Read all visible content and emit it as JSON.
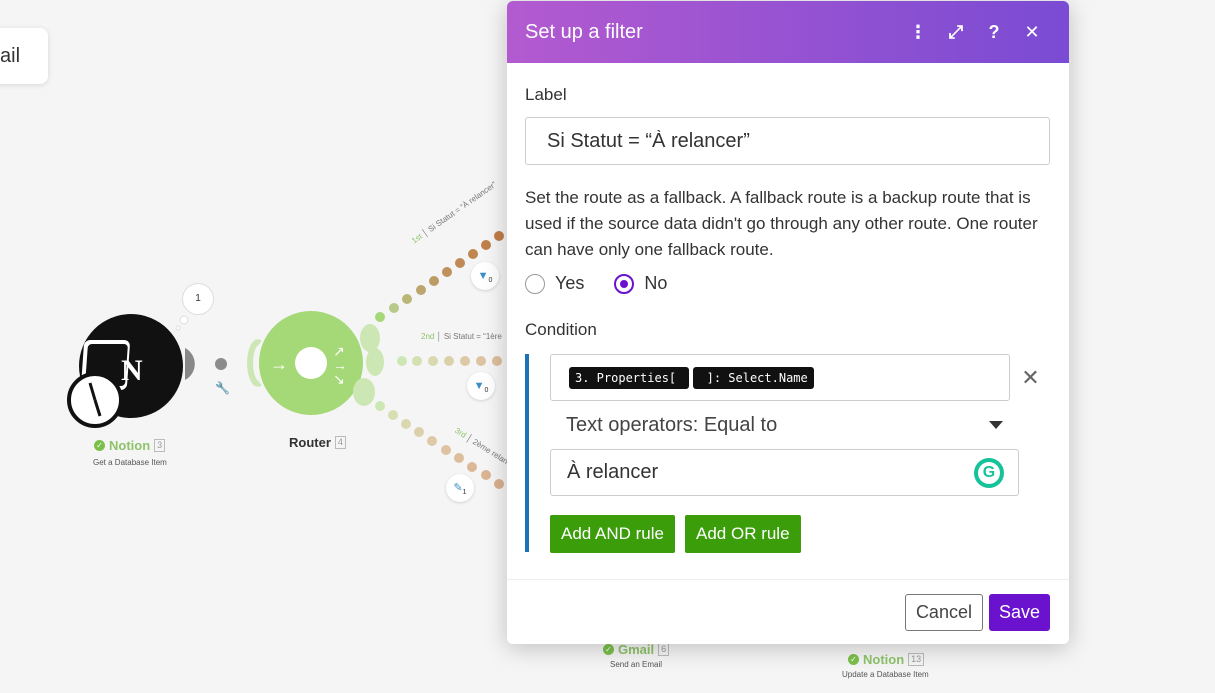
{
  "canvas": {
    "toast_text": "ail",
    "notion_module": {
      "name": "Notion",
      "number": "3",
      "subtitle": "Get a Database Item",
      "ops_count": "1"
    },
    "router_module": {
      "name": "Router",
      "number": "4"
    },
    "gmail_module": {
      "name": "Gmail",
      "number": "6",
      "subtitle": "Send an Email"
    },
    "notion_update_module": {
      "name": "Notion",
      "number": "13",
      "subtitle": "Update a Database Item"
    },
    "routes": [
      {
        "order": "1st",
        "label": "Si Statut = “À relancer”",
        "filter_count": "0"
      },
      {
        "order": "2nd",
        "label": "Si Statut = “1ère",
        "filter_count": "0"
      },
      {
        "order": "3rd",
        "label": "2ème relan",
        "tool_count": "1"
      }
    ]
  },
  "dialog": {
    "title": "Set up a filter",
    "header_icons": [
      "more-vertical-icon",
      "expand-icon",
      "help-icon",
      "close-icon"
    ],
    "label_heading": "Label",
    "label_value": "Si Statut = “À relancer”",
    "fallback_help": "Set the route as a fallback. A fallback route is a backup route that is used if the source data didn't go through any other route. One router can have only one fallback route.",
    "fallback_options": {
      "yes": "Yes",
      "no": "No",
      "selected": "No"
    },
    "condition_heading": "Condition",
    "condition": {
      "operand_pills": [
        "3. Properties[ ",
        " ]: Select.Name"
      ],
      "operator": "Text operators: Equal to",
      "value": "À relancer"
    },
    "add_and_rule": "Add AND rule",
    "add_or_rule": "Add OR rule",
    "cancel": "Cancel",
    "save": "Save"
  },
  "colors": {
    "header_gradient_start": "#b35ad0",
    "header_gradient_end": "#7a4bd3",
    "save_button": "#6b12cf",
    "rule_buttons": "#3c9d0b",
    "router_green": "#a5d877",
    "condition_bar": "#1a73b8"
  }
}
